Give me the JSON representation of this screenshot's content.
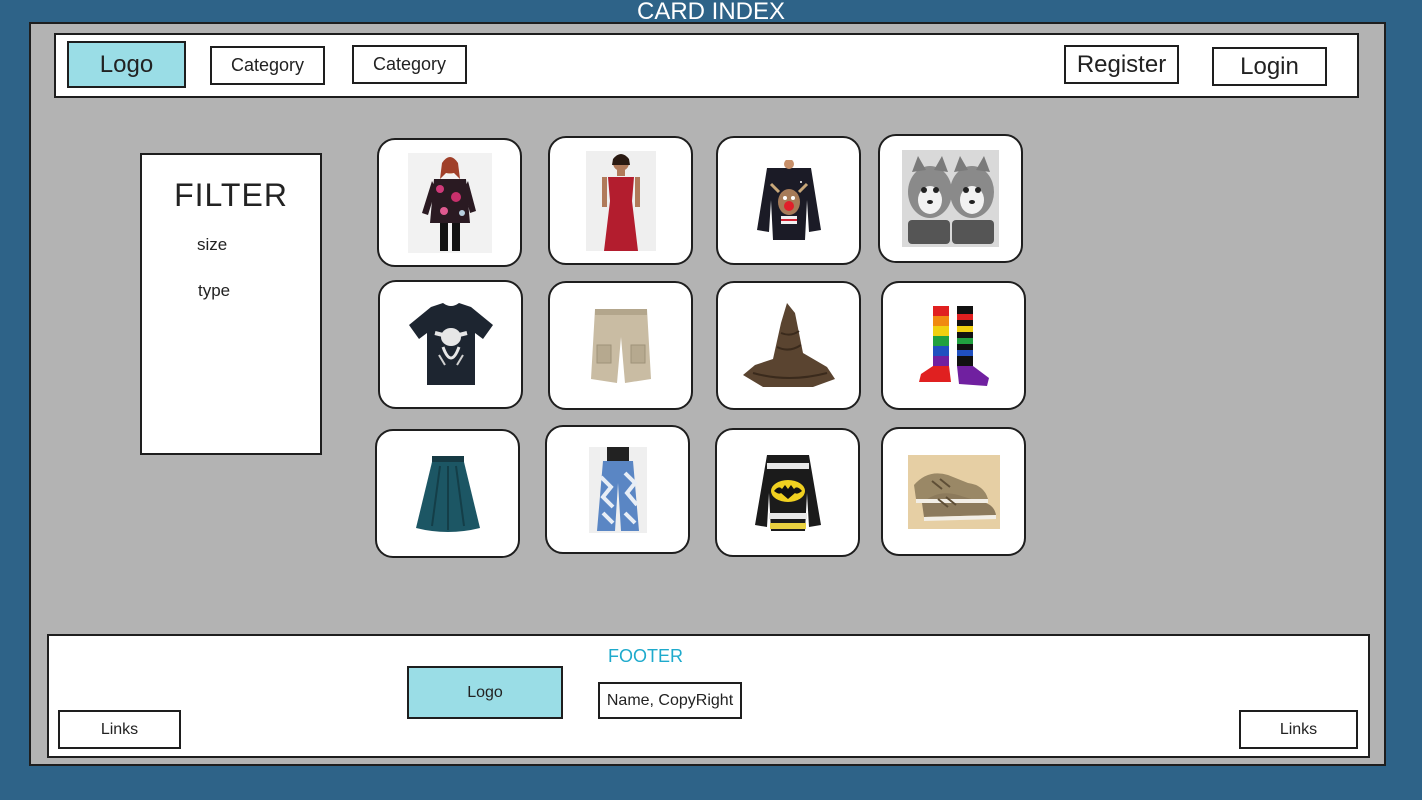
{
  "page_title": "CARD INDEX",
  "header": {
    "logo": "Logo",
    "categories": [
      "Category",
      "Category"
    ],
    "register": "Register",
    "login": "Login"
  },
  "filter": {
    "title": "FILTER",
    "options": [
      "size",
      "type"
    ]
  },
  "products": [
    {
      "item": "floral-blouse"
    },
    {
      "item": "red-dress"
    },
    {
      "item": "reindeer-sweater"
    },
    {
      "item": "husky-mittens"
    },
    {
      "item": "yoda-tshirt"
    },
    {
      "item": "cargo-shorts"
    },
    {
      "item": "sorting-hat"
    },
    {
      "item": "rainbow-socks"
    },
    {
      "item": "teal-skirt"
    },
    {
      "item": "patterned-jeans"
    },
    {
      "item": "batman-sweater"
    },
    {
      "item": "sneakers"
    }
  ],
  "footer": {
    "title": "FOOTER",
    "logo": "Logo",
    "copyright": "Name, CopyRight",
    "links_left": "Links",
    "links_right": "Links"
  },
  "colors": {
    "background": "#2e6388",
    "canvas": "#b3b3b3",
    "logo_fill": "#9adde6",
    "footer_title": "#1eaacc"
  }
}
